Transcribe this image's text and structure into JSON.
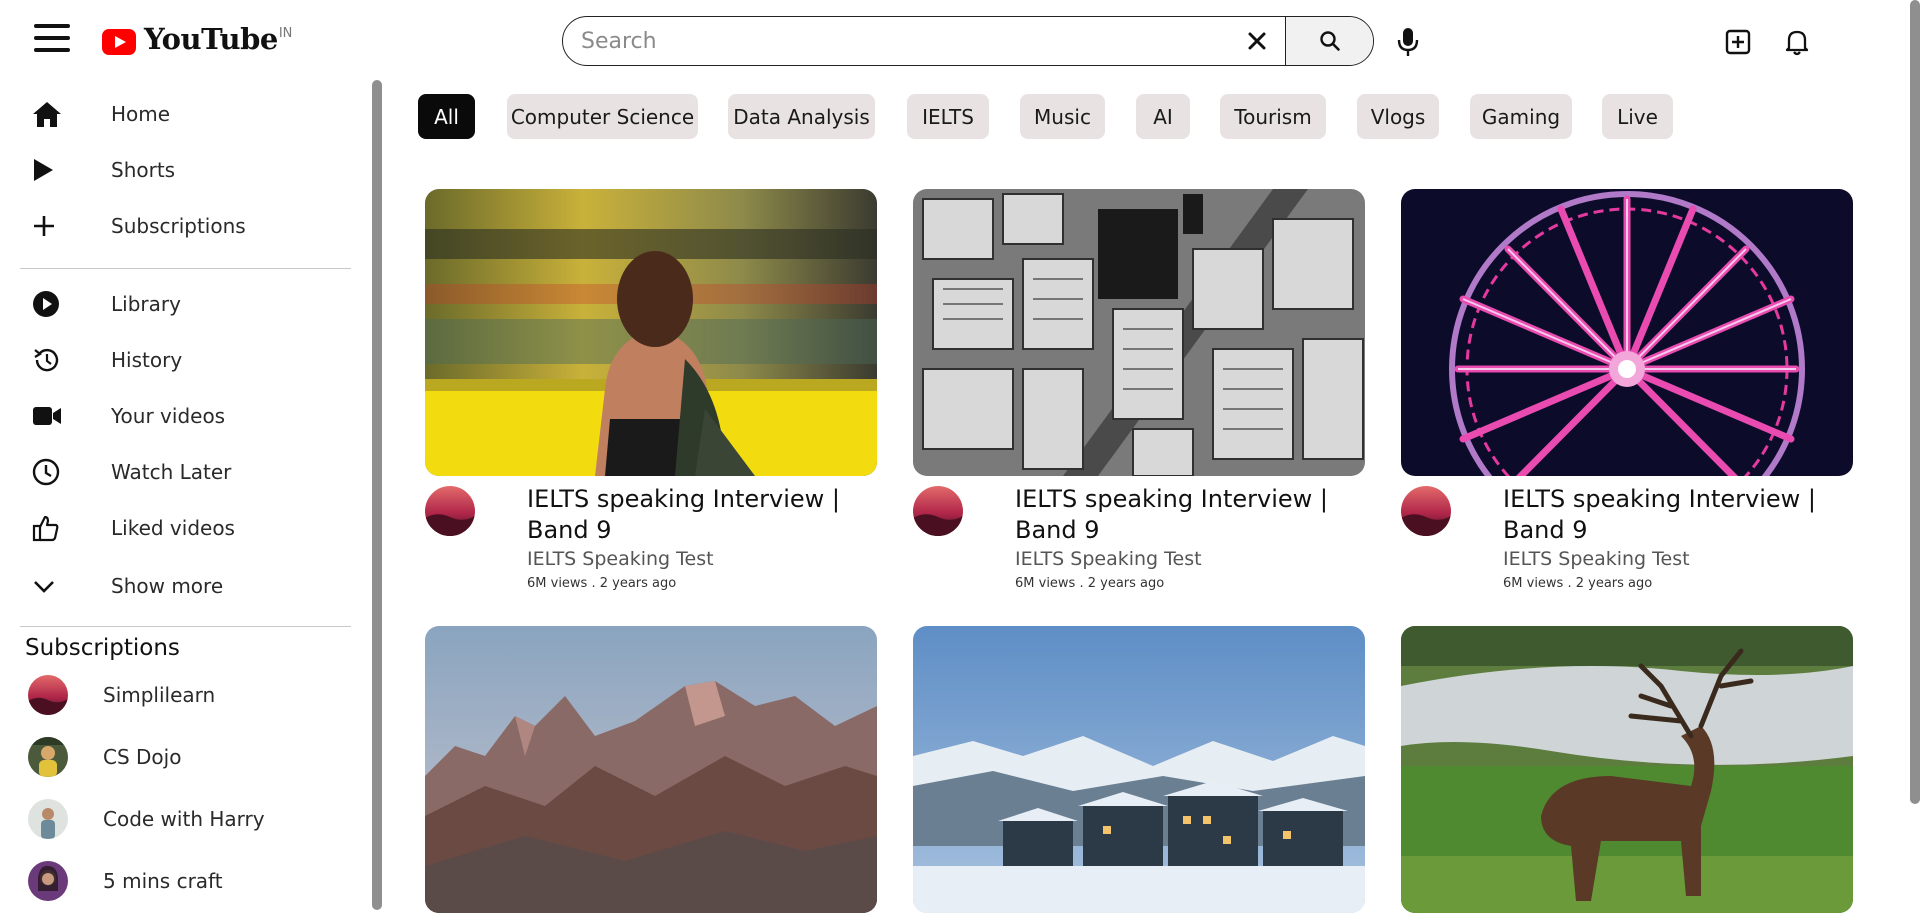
{
  "header": {
    "logo_text": "YouTube",
    "country_code": "IN",
    "search": {
      "placeholder": "Search",
      "value": ""
    }
  },
  "sidebar": {
    "primary": [
      {
        "label": "Home",
        "icon": "home-icon"
      },
      {
        "label": "Shorts",
        "icon": "shorts-play-icon"
      },
      {
        "label": "Subscriptions",
        "icon": "plus-icon"
      }
    ],
    "secondary": [
      {
        "label": "Library",
        "icon": "library-play-icon"
      },
      {
        "label": "History",
        "icon": "history-icon"
      },
      {
        "label": "Your videos",
        "icon": "video-camera-icon"
      },
      {
        "label": "Watch Later",
        "icon": "clock-icon"
      },
      {
        "label": "Liked videos",
        "icon": "thumbs-up-icon"
      },
      {
        "label": "Show more",
        "icon": "chevron-down-icon"
      }
    ],
    "subscriptions_title": "Subscriptions",
    "subscriptions": [
      {
        "name": "Simplilearn"
      },
      {
        "name": "CS Dojo"
      },
      {
        "name": "Code with Harry"
      },
      {
        "name": "5 mins craft"
      }
    ]
  },
  "chips": [
    {
      "label": "All",
      "active": true
    },
    {
      "label": "Computer Science",
      "active": false
    },
    {
      "label": "Data Analysis",
      "active": false
    },
    {
      "label": "IELTS",
      "active": false
    },
    {
      "label": "Music",
      "active": false
    },
    {
      "label": "AI",
      "active": false
    },
    {
      "label": "Tourism",
      "active": false
    },
    {
      "label": "Vlogs",
      "active": false
    },
    {
      "label": "Gaming",
      "active": false
    },
    {
      "label": "Live",
      "active": false
    }
  ],
  "videos": [
    {
      "title": "IELTS speaking Interview | Band 9",
      "channel": "IELTS Speaking Test",
      "stats": "6M views . 2 years ago",
      "thumbnail": "woman-by-moving-train"
    },
    {
      "title": "IELTS speaking Interview | Band 9",
      "channel": "IELTS Speaking Test",
      "stats": "6M views . 2 years ago",
      "thumbnail": "aerial-city-black-white"
    },
    {
      "title": "IELTS speaking Interview | Band 9",
      "channel": "IELTS Speaking Test",
      "stats": "6M views . 2 years ago",
      "thumbnail": "ferris-wheel-night"
    },
    {
      "title": "",
      "channel": "",
      "stats": "",
      "thumbnail": "mountain-peaks"
    },
    {
      "title": "",
      "channel": "",
      "stats": "",
      "thumbnail": "snowy-hotel"
    },
    {
      "title": "",
      "channel": "",
      "stats": "",
      "thumbnail": "deer-in-field"
    }
  ],
  "colors": {
    "brand_red": "#ff0000",
    "chip_bg": "#e8e2e2",
    "chip_active_bg": "#0a0a0a"
  }
}
